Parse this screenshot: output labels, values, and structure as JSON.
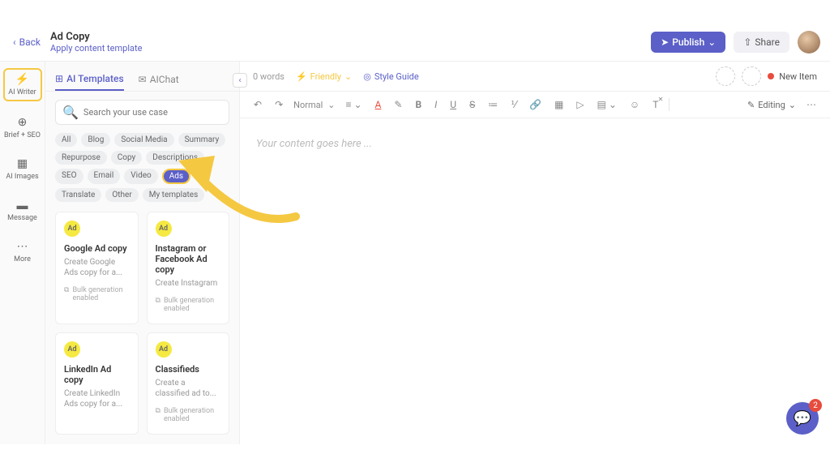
{
  "header": {
    "back": "Back",
    "title": "Ad Copy",
    "subtitle": "Apply content template",
    "publish": "Publish",
    "share": "Share"
  },
  "leftnav": [
    {
      "icon": "⚡",
      "label": "AI Writer",
      "active": true
    },
    {
      "icon": "⊕",
      "label": "Brief + SEO"
    },
    {
      "icon": "▦",
      "label": "AI Images"
    },
    {
      "icon": "▬",
      "label": "Message"
    },
    {
      "icon": "⋯",
      "label": "More"
    }
  ],
  "panel": {
    "tabs": {
      "templates": "AI Templates",
      "chat": "AIChat"
    },
    "search_placeholder": "Search your use case",
    "chips": [
      "All",
      "Blog",
      "Social Media",
      "Summary",
      "Repurpose",
      "Copy",
      "Descriptions",
      "SEO",
      "Email",
      "Video",
      "Ads",
      "Translate",
      "Other",
      "My templates"
    ],
    "selected_chip": "Ads",
    "cards": [
      {
        "title": "Google Ad copy",
        "desc": "Create Google Ads copy for a...",
        "meta": "Bulk generation enabled"
      },
      {
        "title": "Instagram or Facebook Ad copy",
        "desc": "Create Instagram",
        "meta": "Bulk generation enabled"
      },
      {
        "title": "LinkedIn Ad copy",
        "desc": "Create LinkedIn Ads copy for a...",
        "meta": ""
      },
      {
        "title": "Classifieds",
        "desc": "Create a classified ad to...",
        "meta": "Bulk generation enabled"
      }
    ]
  },
  "editor": {
    "words": "0 words",
    "tone": "Friendly",
    "style_guide": "Style Guide",
    "new_item": "New Item",
    "format": "Normal",
    "editing": "Editing",
    "placeholder": "Your content goes here ..."
  },
  "chat": {
    "badge": "2"
  }
}
